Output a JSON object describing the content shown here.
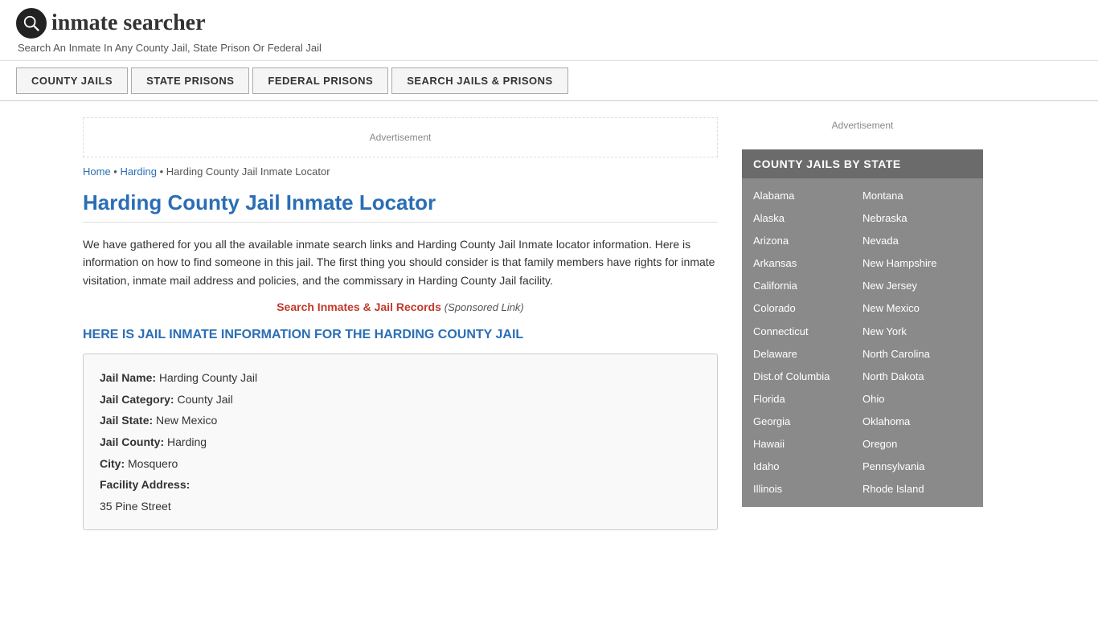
{
  "header": {
    "logo_text": "inmate searcher",
    "tagline": "Search An Inmate In Any County Jail, State Prison Or Federal Jail"
  },
  "nav": {
    "items": [
      {
        "label": "COUNTY JAILS",
        "href": "#"
      },
      {
        "label": "STATE PRISONS",
        "href": "#"
      },
      {
        "label": "FEDERAL PRISONS",
        "href": "#"
      },
      {
        "label": "SEARCH JAILS & PRISONS",
        "href": "#"
      }
    ]
  },
  "breadcrumb": {
    "home": "Home",
    "parent": "Harding",
    "current": "Harding County Jail Inmate Locator"
  },
  "page": {
    "title": "Harding County Jail Inmate Locator",
    "body_text": "We have gathered for you all the available inmate search links and Harding County Jail Inmate locator information. Here is information on how to find someone in this jail. The first thing you should consider is that family members have rights for inmate visitation, inmate mail address and policies, and the commissary in Harding County Jail facility.",
    "sponsored_link_text": "Search Inmates & Jail Records",
    "sponsored_label": "(Sponsored Link)",
    "section_heading": "HERE IS JAIL INMATE INFORMATION FOR THE HARDING COUNTY JAIL",
    "jail_info": {
      "name_label": "Jail Name:",
      "name_value": "Harding County Jail",
      "category_label": "Jail Category:",
      "category_value": "County Jail",
      "state_label": "Jail State:",
      "state_value": "New Mexico",
      "county_label": "Jail County:",
      "county_value": "Harding",
      "city_label": "City:",
      "city_value": "Mosquero",
      "address_label": "Facility Address:",
      "address_value": "35 Pine Street"
    }
  },
  "sidebar": {
    "ad_label": "Advertisement",
    "box_title": "COUNTY JAILS BY STATE",
    "states_left": [
      "Alabama",
      "Alaska",
      "Arizona",
      "Arkansas",
      "California",
      "Colorado",
      "Connecticut",
      "Delaware",
      "Dist.of Columbia",
      "Florida",
      "Georgia",
      "Hawaii",
      "Idaho",
      "Illinois"
    ],
    "states_right": [
      "Montana",
      "Nebraska",
      "Nevada",
      "New Hampshire",
      "New Jersey",
      "New Mexico",
      "New York",
      "North Carolina",
      "North Dakota",
      "Ohio",
      "Oklahoma",
      "Oregon",
      "Pennsylvania",
      "Rhode Island"
    ]
  },
  "ad_banner_label": "Advertisement"
}
